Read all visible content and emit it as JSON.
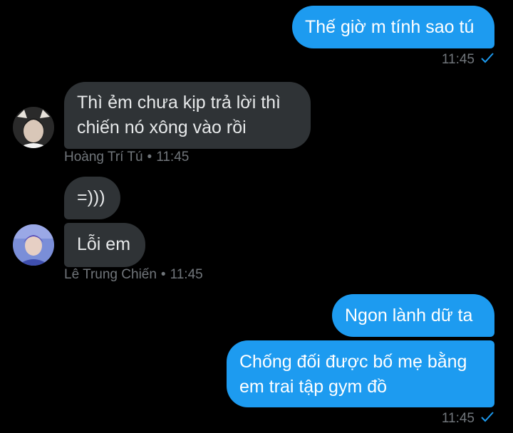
{
  "colors": {
    "background": "#000000",
    "outgoing_bubble": "#1d9bf0",
    "incoming_bubble": "#2f3336",
    "meta_text": "#71767b",
    "read_check": "#1d9bf0"
  },
  "messages": {
    "m1": {
      "text": "Thế giờ m tính sao tú",
      "time": "11:45",
      "status_icon": "read-check-icon"
    },
    "m2": {
      "line1": "Thì ẻm chưa kịp trả lời thì",
      "line2": "chiến nó xông vào rồi"
    },
    "m2_meta": {
      "sender": "Hoàng Trí Tú",
      "separator": "•",
      "time": "11:45"
    },
    "m3": {
      "text": "=)))"
    },
    "m4": {
      "text": "Lỗi em"
    },
    "m4_meta": {
      "sender": "Lê Trung Chiến",
      "separator": "•",
      "time": "11:45"
    },
    "m5": {
      "text": "Ngon lành dữ ta"
    },
    "m6": {
      "line1": "Chống đối được bố mẹ bằng",
      "line2": "em trai tập gym đồ",
      "time": "11:45",
      "status_icon": "read-check-icon"
    }
  }
}
